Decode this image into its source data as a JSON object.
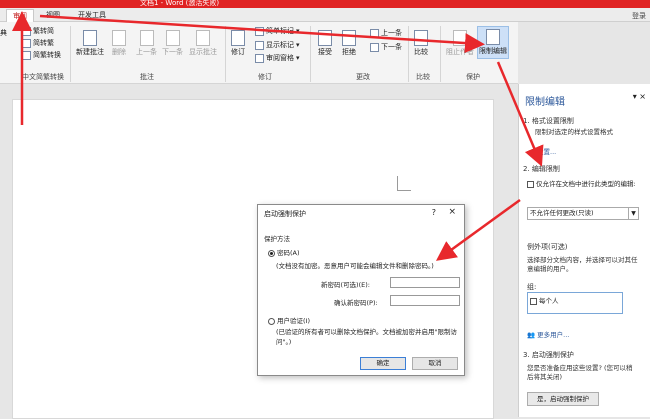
{
  "title_bar": {
    "text": "文档1 - Word (激活失败)"
  },
  "tabs": [
    {
      "label": "审阅",
      "active": true
    },
    {
      "label": "视图",
      "active": false
    },
    {
      "label": "开发工具",
      "active": false
    }
  ],
  "login": "登录",
  "ribbon": {
    "chinese_conv": {
      "left_cut": "典",
      "to_trad": "繁转简",
      "to_simp": "简转繁",
      "conv": "简繁转换",
      "group": "中文简繁转换"
    },
    "comments": {
      "new": "新建批注",
      "delete": "删除",
      "prev": "上一条",
      "next": "下一条",
      "show": "显示批注",
      "group": "批注"
    },
    "tracking": {
      "revise": "修订",
      "simple_markup": "简单标记",
      "show_markup": "显示标记",
      "review_pane": "审阅窗格",
      "group": "修订"
    },
    "changes": {
      "accept": "接受",
      "reject": "拒绝",
      "prev": "上一条",
      "next": "下一条",
      "group": "更改"
    },
    "compare": {
      "compare": "比较",
      "group": "比较"
    },
    "protect": {
      "block_authors": "阻止作者",
      "restrict_editing": "限制编辑",
      "group": "保护"
    }
  },
  "pane": {
    "title": "限制编辑",
    "controls": "▾ ×",
    "s1_head": "1. 格式设置限制",
    "s1_text": "限制对选定的样式设置格式",
    "s1_link": "设置...",
    "s2_head": "2. 编辑限制",
    "s2_check": "仅允许在文档中进行此类型的编辑:",
    "s2_dropdown": "不允许任何更改(只读)",
    "exceptions_head": "例外项(可选)",
    "exceptions_text": "选择部分文档内容，并选择可以对其任意编辑的用户。",
    "group_label": "组:",
    "group_item": "每个人",
    "more_users": "更多用户...",
    "s3_head": "3. 启动强制保护",
    "s3_text": "您是否准备应用这些设置? (您可以稍后将其关闭)",
    "s3_button": "是，启动强制保护"
  },
  "dialog": {
    "title": "启动强制保护",
    "help": "?",
    "close": "×",
    "method": "保护方法",
    "password_radio": "密码(A)",
    "password_note": "(文档没有加密。恶意用户可能会编辑文件和删除密码。)",
    "new_pw_label": "新密码(可选)(E):",
    "confirm_pw_label": "确认新密码(P):",
    "user_auth_radio": "用户验证(I)",
    "user_auth_note": "(已验证的所有者可以删除文档保护。文档被加密并启用\"限制访问\"。)",
    "ok": "确定",
    "cancel": "取消"
  },
  "annotation_color": "#e8282c"
}
